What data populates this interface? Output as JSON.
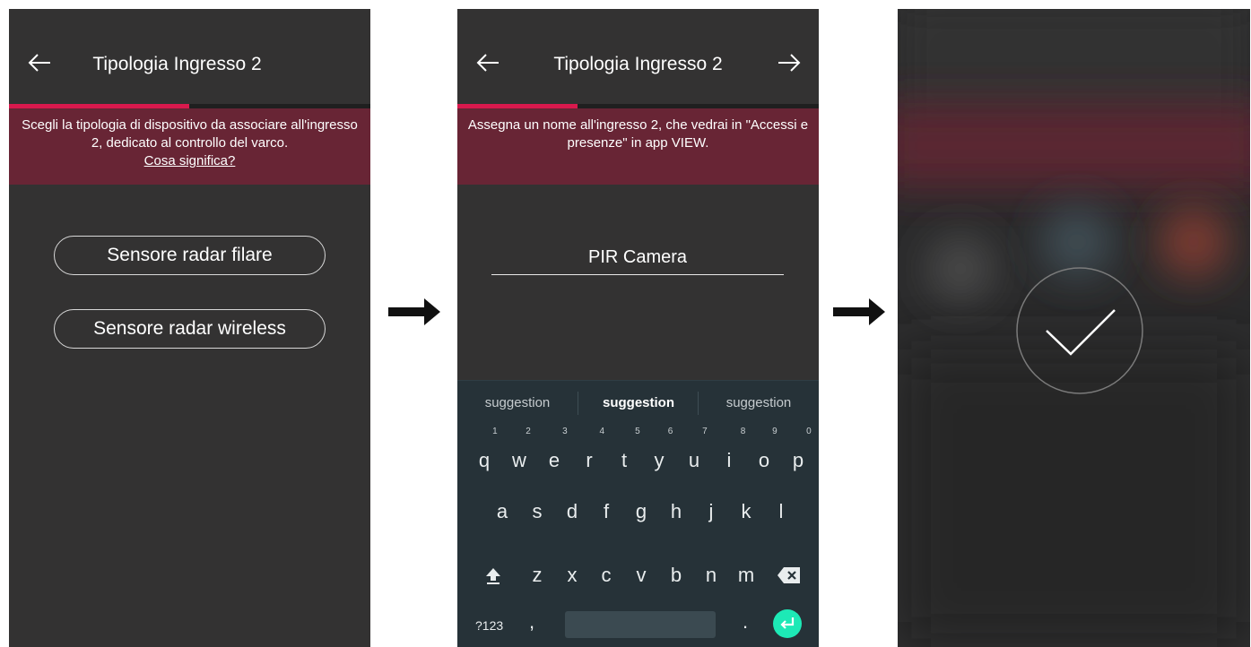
{
  "screen1": {
    "title": "Tipologia Ingresso 2",
    "progress_fraction": 0.5,
    "instruction": "Scegli la tipologia di dispositivo da associare all'ingresso 2, dedicato al controllo del varco.",
    "help_link": "Cosa significa?",
    "options": [
      "Sensore radar filare",
      "Sensore radar wireless"
    ]
  },
  "screen2": {
    "title": "Tipologia Ingresso 2",
    "progress_fraction": 0.33,
    "instruction": "Assegna un nome all'ingresso 2, che vedrai in \"Accessi e presenze\" in app VIEW.",
    "input_value": "PIR Camera",
    "keyboard": {
      "suggestions": [
        "suggestion",
        "suggestion",
        "suggestion"
      ],
      "row1": [
        "q",
        "w",
        "e",
        "r",
        "t",
        "y",
        "u",
        "i",
        "o",
        "p"
      ],
      "row1_hints": [
        "1",
        "2",
        "3",
        "4",
        "5",
        "6",
        "7",
        "8",
        "9",
        "0"
      ],
      "row2": [
        "a",
        "s",
        "d",
        "f",
        "g",
        "h",
        "j",
        "k",
        "l"
      ],
      "row3": [
        "z",
        "x",
        "c",
        "v",
        "b",
        "n",
        "m"
      ],
      "symbols_key": "?123",
      "comma_key": ",",
      "period_key": "."
    }
  },
  "screen3": {
    "status": "success"
  },
  "colors": {
    "accent": "#d9194d",
    "banner": "#682535",
    "screen_bg": "#333232",
    "keyboard_bg": "#263238",
    "enter_key": "#1de9b6"
  },
  "icons": [
    "back-arrow-icon",
    "forward-arrow-icon",
    "flow-arrow-icon",
    "shift-icon",
    "backspace-icon",
    "enter-icon",
    "checkmark-icon"
  ]
}
